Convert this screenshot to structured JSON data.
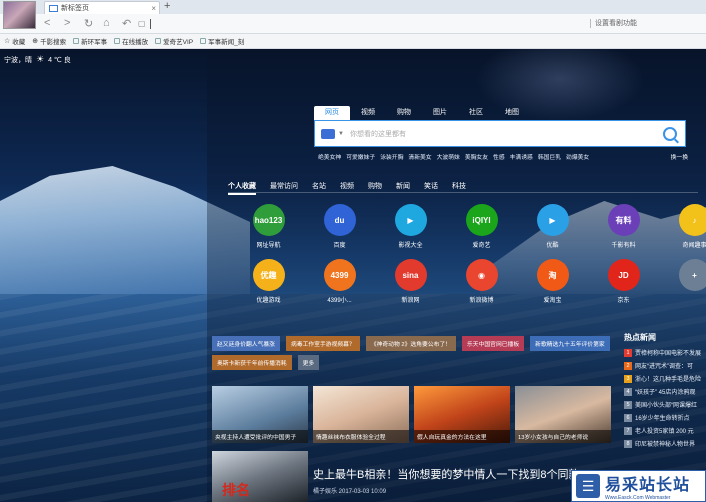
{
  "browser": {
    "tab_title": "新标签页",
    "tab_close": "×",
    "new_tab": "+",
    "promo_text": "设置看剧功能",
    "nav": {
      "back": "<",
      "forward": ">",
      "refresh": "↻",
      "home": "⌂",
      "undo": "↶",
      "page": "▢"
    }
  },
  "favorites": [
    {
      "label": "收藏",
      "icon": "star-icon"
    },
    {
      "label": "千影搜索",
      "icon": "search-icon"
    },
    {
      "label": "新环军事",
      "icon": "page-icon"
    },
    {
      "label": "在线播放",
      "icon": "page-icon"
    },
    {
      "label": "爱奇艺VIP",
      "icon": "page-icon"
    },
    {
      "label": "军事新闻_刻",
      "icon": "page-icon"
    }
  ],
  "weather": {
    "city": "宁波，晴",
    "temp": "4 ℃ 良"
  },
  "search": {
    "tabs": [
      "网页",
      "视频",
      "购物",
      "图片",
      "社区",
      "地图"
    ],
    "active_tab": "网页",
    "placeholder": "你想看的这里都有",
    "hot": [
      "绝美女神",
      "可爱嫩妹子",
      "泳装开胸",
      "清新美女",
      "大波萌妹",
      "美胸女友",
      "性感",
      "丰满诱惑",
      "韩国巨乳",
      "劲爆美女"
    ],
    "refresh": "换一换"
  },
  "categories": [
    "个人收藏",
    "最常访问",
    "名站",
    "视频",
    "购物",
    "新闻",
    "笑话",
    "科技"
  ],
  "apps": [
    {
      "label": "网址导航",
      "text": "hao123",
      "color": "#2f9d3a"
    },
    {
      "label": "百度",
      "text": "du",
      "color": "#2f63d6"
    },
    {
      "label": "影视大全",
      "text": "▶",
      "color": "#1fa7e0"
    },
    {
      "label": "爱奇艺",
      "text": "iQIYI",
      "color": "#1aa51a"
    },
    {
      "label": "优酷",
      "text": "▶",
      "color": "#2aa0e6"
    },
    {
      "label": "千影有料",
      "text": "有料",
      "color": "#6a3fb8"
    },
    {
      "label": "奇闻趣事",
      "text": "♪",
      "color": "#f2c21a"
    },
    {
      "label": "优趣游戏",
      "text": "优趣",
      "color": "#f5b11a"
    },
    {
      "label": "4399小...",
      "text": "4399",
      "color": "#f0741e"
    },
    {
      "label": "新浪网",
      "text": "sina",
      "color": "#e23a2d"
    },
    {
      "label": "新浪微博",
      "text": "◉",
      "color": "#e9452f"
    },
    {
      "label": "爱淘宝",
      "text": "淘",
      "color": "#f05a16"
    },
    {
      "label": "京东",
      "text": "JD",
      "color": "#e1251b"
    },
    {
      "label": "",
      "text": "+",
      "color": "#6d7f95"
    }
  ],
  "tags": [
    {
      "text": "赵又廷身价翻人气暴涨",
      "color": "#4870b8"
    },
    {
      "text": "病毒工作室手游视频幕？",
      "color": "#b06a2c"
    },
    {
      "text": "《神奇动物 2》选角要公布了！",
      "color": "#8a6a4e"
    },
    {
      "text": "乐天中国官网已播板",
      "color": "#b63b55"
    },
    {
      "text": "新歌精选九十五年评价第家",
      "color": "#3e6db8"
    },
    {
      "text": "奥斯卡新获千年前传播消耗",
      "color": "#b06a2c"
    },
    {
      "text": "更多",
      "color": "#5a6a80"
    }
  ],
  "news_cards": [
    {
      "caption": "央视主持人遭受批评的中国男子"
    },
    {
      "caption": "情趣丝袜布衣服体验全过程"
    },
    {
      "caption": "假人自玩真金的方法在这里"
    },
    {
      "caption": "13岁小女孩与自己的老师说"
    }
  ],
  "feature": {
    "title": "史上最牛B相亲！当你想要的梦中情人一下找到8个同款",
    "meta": "橘子娱乐 2017-03-03 10:09",
    "image_text": "排名"
  },
  "hot_news": {
    "title": "热点新闻",
    "items": [
      {
        "n": "1",
        "text": "贾樟柯称中国电影不发展",
        "color": "#e03c31"
      },
      {
        "n": "2",
        "text": "网友“进咒术”调查：可",
        "color": "#e86a1a"
      },
      {
        "n": "3",
        "text": "浙心！这几种手毛是危险",
        "color": "#e8a21a"
      },
      {
        "n": "4",
        "text": "“妖孩子” 45店内涂鸦观",
        "color": "#7a8aa0"
      },
      {
        "n": "5",
        "text": "美国小伙头部“网课爆红",
        "color": "#7a8aa0"
      },
      {
        "n": "6",
        "text": "16岁少年生命转折点",
        "color": "#7a8aa0"
      },
      {
        "n": "7",
        "text": "老人投资5家镇 200 元",
        "color": "#7a8aa0"
      },
      {
        "n": "8",
        "text": "印尼被禁神秘人物世界",
        "color": "#7a8aa0"
      }
    ]
  },
  "watermark": {
    "brand": "易采站长站",
    "sub": "Www.Easck.Com Webmaster"
  },
  "colors": {
    "accent": "#3a93e6",
    "page_bg": "#0b1d3a"
  }
}
